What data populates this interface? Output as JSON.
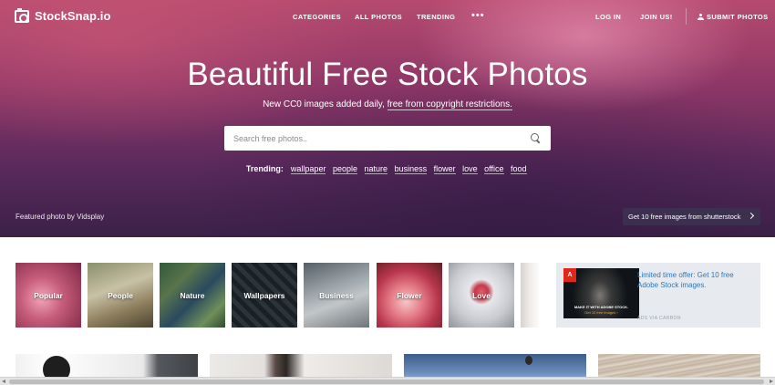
{
  "brand": {
    "name": "StockSnap.io"
  },
  "nav": {
    "categories": "CATEGORIES",
    "all_photos": "ALL PHOTOS",
    "trending": "TRENDING",
    "more": "•••",
    "login": "LOG IN",
    "join": "JOIN US!",
    "submit": "SUBMIT PHOTOS"
  },
  "hero": {
    "title": "Beautiful Free Stock Photos",
    "subtitle_prefix": "New CC0 images added daily, ",
    "subtitle_link": "free from copyright restrictions.",
    "search_placeholder": "Search free photos..",
    "trending_label": "Trending:",
    "trending_terms": [
      "wallpaper",
      "people",
      "nature",
      "business",
      "flower",
      "love",
      "office",
      "food"
    ],
    "featured_prefix": "Featured photo by ",
    "featured_author": "Vidsplay",
    "shutterstock_button": "Get 10 free images from shutterstock"
  },
  "categories": [
    "Popular",
    "People",
    "Nature",
    "Wallpapers",
    "Business",
    "Flower",
    "Love"
  ],
  "ad": {
    "logo": "A",
    "image_line1": "MAKE IT WITH ADOBE STOCK.",
    "image_line2": "Get 10 free images ›",
    "text": "Limited time offer: Get 10 free Adobe Stock images.",
    "via": "ADS VIA CARBON"
  }
}
